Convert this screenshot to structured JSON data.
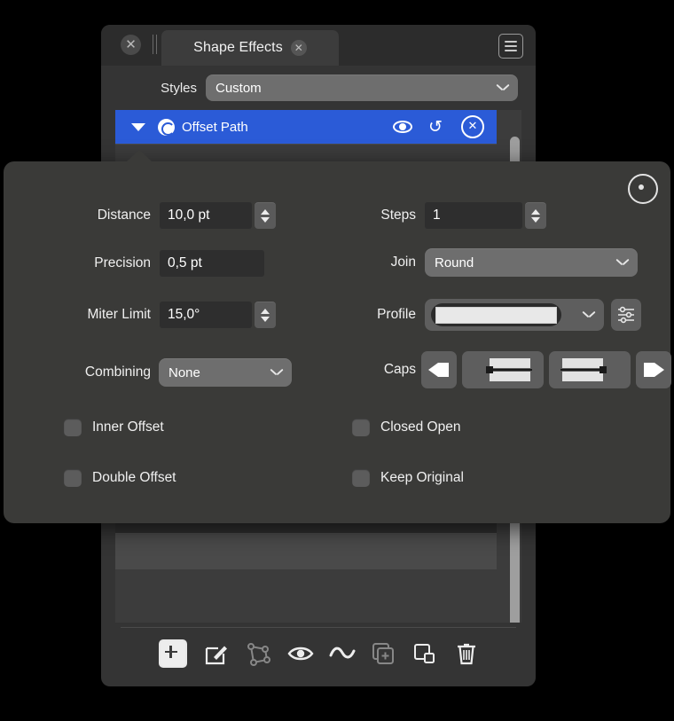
{
  "window": {
    "tab_label": "Shape Effects",
    "close_icon": "close-icon",
    "tab_close_icon": "close-icon",
    "menu_icon": "hamburger-menu-icon"
  },
  "styles": {
    "label": "Styles",
    "value": "Custom"
  },
  "effect": {
    "name": "Offset Path",
    "disclosure_icon": "triangle-down-icon",
    "type_icon": "spiral-icon",
    "visibility_icon": "eye-icon",
    "reset_icon": "reset-icon",
    "remove_icon": "close-circle-icon",
    "selected_color": "#2b5bd7"
  },
  "popover": {
    "record_icon": "record-icon",
    "fields": {
      "distance": {
        "label": "Distance",
        "value": "10,0 pt",
        "stepper": true
      },
      "precision": {
        "label": "Precision",
        "value": "0,5 pt",
        "stepper": false
      },
      "miter_limit": {
        "label": "Miter Limit",
        "value": "15,0°",
        "stepper": true
      },
      "combining": {
        "label": "Combining",
        "value": "None"
      },
      "steps": {
        "label": "Steps",
        "value": "1",
        "stepper": true
      },
      "join": {
        "label": "Join",
        "value": "Round"
      },
      "profile": {
        "label": "Profile",
        "value": "",
        "options_icon": "sliders-icon"
      },
      "caps": {
        "label": "Caps"
      }
    },
    "caps_buttons": [
      {
        "name": "cap-start-arrow",
        "icon": "arrow-left-solid-icon"
      },
      {
        "name": "cap-start-flat",
        "icon": "cap-flat-left-icon"
      },
      {
        "name": "cap-end-flat",
        "icon": "cap-flat-right-icon"
      },
      {
        "name": "cap-end-arrow",
        "icon": "arrow-right-solid-icon"
      }
    ],
    "checkboxes": [
      {
        "name": "inner-offset",
        "label": "Inner Offset",
        "checked": false
      },
      {
        "name": "closed-open",
        "label": "Closed Open",
        "checked": false
      },
      {
        "name": "double-offset",
        "label": "Double Offset",
        "checked": false
      },
      {
        "name": "keep-original",
        "label": "Keep Original",
        "checked": false
      }
    ]
  },
  "toolbar": {
    "items": [
      {
        "name": "add-effect-button",
        "icon": "plus-square-filled-icon",
        "enabled": true
      },
      {
        "name": "edit-effect-button",
        "icon": "edit-square-icon",
        "enabled": true
      },
      {
        "name": "node-edit-button",
        "icon": "polygon-nodes-icon",
        "enabled": false
      },
      {
        "name": "toggle-visibility-button",
        "icon": "eye-icon",
        "enabled": true
      },
      {
        "name": "smooth-button",
        "icon": "wave-icon",
        "enabled": true
      },
      {
        "name": "duplicate-button",
        "icon": "duplicate-plus-icon",
        "enabled": false
      },
      {
        "name": "group-button",
        "icon": "shapes-overlap-icon",
        "enabled": true
      },
      {
        "name": "delete-button",
        "icon": "trash-icon",
        "enabled": true
      }
    ]
  },
  "colors": {
    "background": "#000000",
    "window": "#343434",
    "titlebar": "#2c2c2c",
    "popover": "#3a3a38",
    "accent": "#2b5bd7",
    "field": "#2e2e2e",
    "control": "#5e5e5e"
  }
}
